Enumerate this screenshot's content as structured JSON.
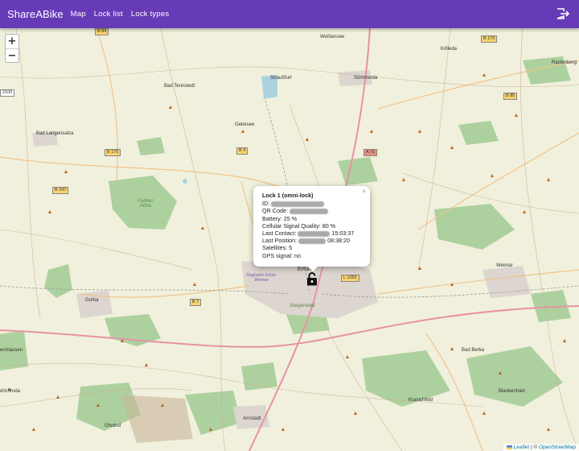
{
  "app": {
    "brand": "ShareABike",
    "nav": [
      "Map",
      "Lock list",
      "Lock types"
    ],
    "logout_icon": "logout-icon"
  },
  "map": {
    "zoom_in": "+",
    "zoom_out": "−",
    "places": {
      "weissensee": "Weißensee",
      "kolleda": "Kölleda",
      "rastenberg": "Rastenberg",
      "bad_tennstedt": "Bad Tennstedt",
      "strausfurt": "Straußfurt",
      "sommerda": "Sömmerda",
      "bad_langensalza": "Bad Langensalza",
      "gebesee": "Gebesee",
      "fahner_hohe": "Fahner Höhe",
      "flughafen": "Flughafen Erfurt-Weimar",
      "erfurt": "Erfurt",
      "steigerwald": "Steigerwald",
      "weimar": "Weimar",
      "gotha": "Gotha",
      "bad_berka": "Bad Berka",
      "waltershausen": "ershausen",
      "friedrichroda": "drichroda",
      "kranichfeld": "Kranichfeld",
      "blankenhain": "Blankenhain",
      "ohrdruf": "Ohrdruf",
      "arnstadt": "Arnstadt"
    },
    "roads": {
      "b84": "B 84",
      "b176a": "B 176",
      "b176b": "B 176",
      "b85": "B 85",
      "b4": "B 4",
      "a71": "A 71",
      "b247": "B 247",
      "b7": "B 7",
      "l1052": "L 1052",
      "r2100": "2100"
    }
  },
  "popup": {
    "title": "Lock 1 (omni-lock)",
    "id_label": "ID:",
    "qr_label": "QR Code:",
    "battery": "Battery: 25 %",
    "signal": "Cellular Signal Quality: 80 %",
    "last_contact_label": "Last Contact:",
    "last_contact_time": "15:03:37",
    "last_position_label": "Last Position:",
    "last_position_time": "08:38:20",
    "satellites": "Satellites: 5",
    "gps": "GPS signal: no",
    "close": "×"
  },
  "attribution": {
    "leaflet": "Leaflet",
    "separator": " | © ",
    "osm": "OpenStreetMap"
  },
  "colors": {
    "appbar": "#673ab7",
    "map_bg": "#f2efe9",
    "forest": "#add19e",
    "motorway": "#e892a2",
    "primary": "#fcd6a4"
  }
}
